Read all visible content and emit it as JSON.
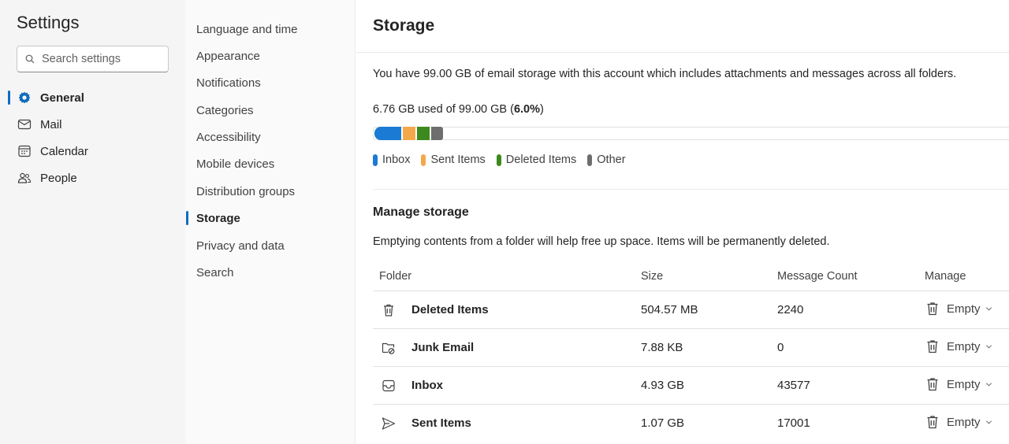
{
  "app": {
    "title": "Settings",
    "search_placeholder": "Search settings"
  },
  "nav": {
    "items": [
      {
        "label": "General",
        "icon": "gear-icon"
      },
      {
        "label": "Mail",
        "icon": "mail-icon"
      },
      {
        "label": "Calendar",
        "icon": "calendar-icon"
      },
      {
        "label": "People",
        "icon": "people-icon"
      }
    ]
  },
  "subnav": {
    "items": [
      {
        "label": "Language and time"
      },
      {
        "label": "Appearance"
      },
      {
        "label": "Notifications"
      },
      {
        "label": "Categories"
      },
      {
        "label": "Accessibility"
      },
      {
        "label": "Mobile devices"
      },
      {
        "label": "Distribution groups"
      },
      {
        "label": "Storage"
      },
      {
        "label": "Privacy and data"
      },
      {
        "label": "Search"
      }
    ]
  },
  "main": {
    "title": "Storage",
    "description": "You have 99.00 GB of email storage with this account which includes attachments and messages across all folders.",
    "usage_prefix": "6.76 GB used of 99.00 GB (",
    "usage_percent": "6.0%",
    "usage_suffix": ")",
    "legend": [
      {
        "label": "Inbox",
        "color": "#1a7ad4"
      },
      {
        "label": "Sent Items",
        "color": "#f3a94b"
      },
      {
        "label": "Deleted Items",
        "color": "#3c8a1d"
      },
      {
        "label": "Other",
        "color": "#6e6e6e"
      }
    ],
    "manage_title": "Manage storage",
    "manage_description": "Emptying contents from a folder will help free up space. Items will be permanently deleted.",
    "table": {
      "headers": {
        "folder": "Folder",
        "size": "Size",
        "count": "Message Count",
        "manage": "Manage"
      },
      "rows": [
        {
          "folder": "Deleted Items",
          "icon": "trash-icon",
          "size": "504.57 MB",
          "count": "2240",
          "action": "Empty"
        },
        {
          "folder": "Junk Email",
          "icon": "junk-folder-icon",
          "size": "7.88 KB",
          "count": "0",
          "action": "Empty"
        },
        {
          "folder": "Inbox",
          "icon": "inbox-icon",
          "size": "4.93 GB",
          "count": "43577",
          "action": "Empty"
        },
        {
          "folder": "Sent Items",
          "icon": "send-icon",
          "size": "1.07 GB",
          "count": "17001",
          "action": "Empty"
        }
      ]
    }
  }
}
